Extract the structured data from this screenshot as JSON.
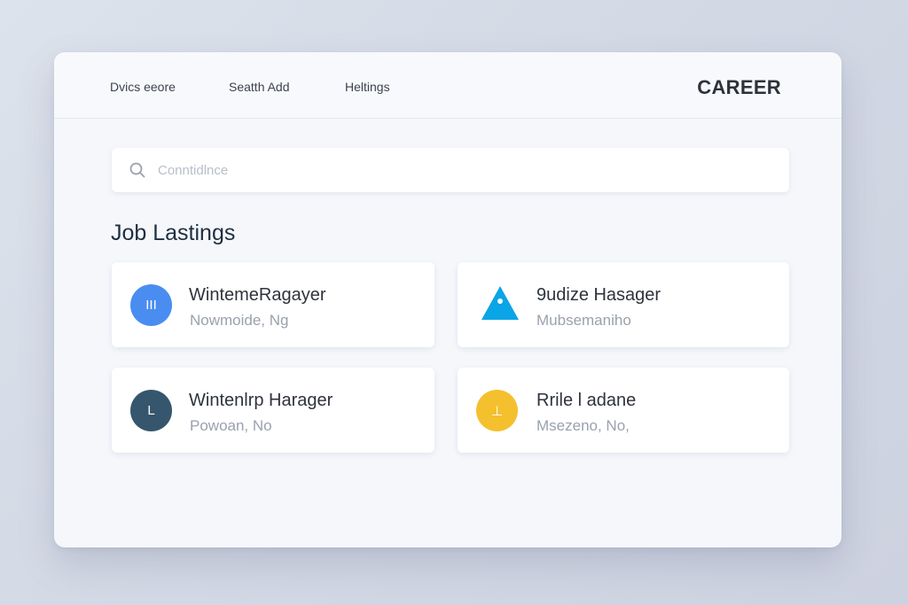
{
  "nav": {
    "items": [
      {
        "label": "Dvics eeore"
      },
      {
        "label": "Seatth Add"
      },
      {
        "label": "Heltings"
      }
    ],
    "brand": "CAREER"
  },
  "search": {
    "placeholder": "Conntidlnce",
    "icon": "search-icon"
  },
  "section": {
    "title": "Job Lastings"
  },
  "jobs": [
    {
      "title": "WintemeRagayer",
      "subtitle": "Nowmoide,  Ng",
      "logo_text": "III",
      "logo_color": "#4a8df0",
      "logo_shape": "circle"
    },
    {
      "title": "9udize Hasager",
      "subtitle": "Mubsemaniho",
      "logo_text": "",
      "logo_color": "#0aa5e6",
      "logo_shape": "triangle"
    },
    {
      "title": "Wintenlrp Harager",
      "subtitle": "Powoan, No",
      "logo_text": "L",
      "logo_color": "#36566d",
      "logo_shape": "circle"
    },
    {
      "title": "Rrile l adane",
      "subtitle": "Msezeno, No,",
      "logo_text": "⊥",
      "logo_color": "#f5c02e",
      "logo_shape": "circle"
    }
  ],
  "colors": {
    "background": "#d8dde8",
    "window": "#f5f7fb",
    "card": "#ffffff",
    "title_text": "#1f2f3f"
  }
}
